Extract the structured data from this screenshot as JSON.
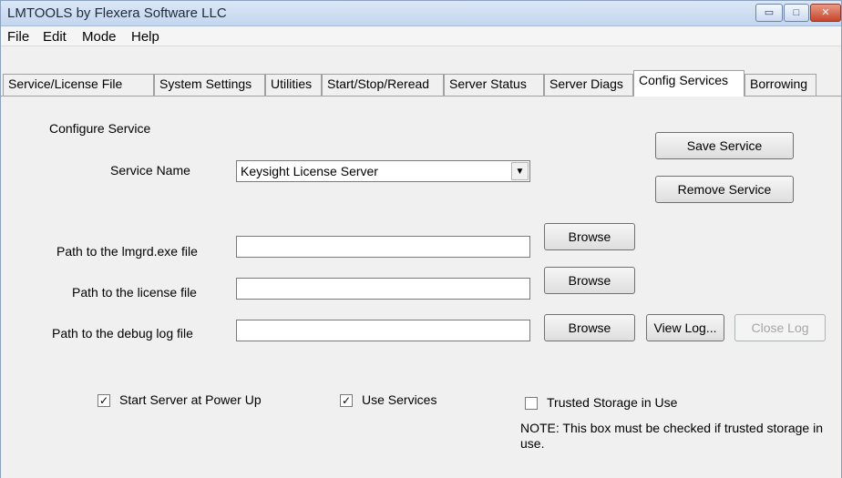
{
  "window": {
    "title": "LMTOOLS by Flexera Software LLC",
    "controls": {
      "minimize": "▭",
      "maximize": "□",
      "close": "✕"
    }
  },
  "menu": {
    "file": "File",
    "edit": "Edit",
    "mode": "Mode",
    "help": "Help"
  },
  "tabs": [
    {
      "label": "Service/License File"
    },
    {
      "label": "System Settings"
    },
    {
      "label": "Utilities"
    },
    {
      "label": "Start/Stop/Reread"
    },
    {
      "label": "Server Status"
    },
    {
      "label": "Server Diags"
    },
    {
      "label": "Config Services",
      "active": true
    },
    {
      "label": "Borrowing"
    }
  ],
  "config": {
    "section_title": "Configure Service",
    "service_name_label": "Service Name",
    "service_name_value": "Keysight License Server",
    "save_service": "Save Service",
    "remove_service": "Remove Service",
    "lmgrd_label": "Path to the lmgrd.exe file",
    "lmgrd_value": "",
    "license_label": "Path to the license file",
    "license_value": "",
    "debug_label": "Path to the debug log file",
    "debug_value": "",
    "browse": "Browse",
    "view_log": "View Log...",
    "close_log": "Close Log",
    "start_at_power_up": {
      "label": "Start Server at Power Up",
      "checked": true
    },
    "use_services": {
      "label": "Use Services",
      "checked": true
    },
    "trusted_storage": {
      "label": "Trusted Storage in Use",
      "checked": false
    },
    "note": "NOTE: This box must be checked if trusted storage in use."
  }
}
